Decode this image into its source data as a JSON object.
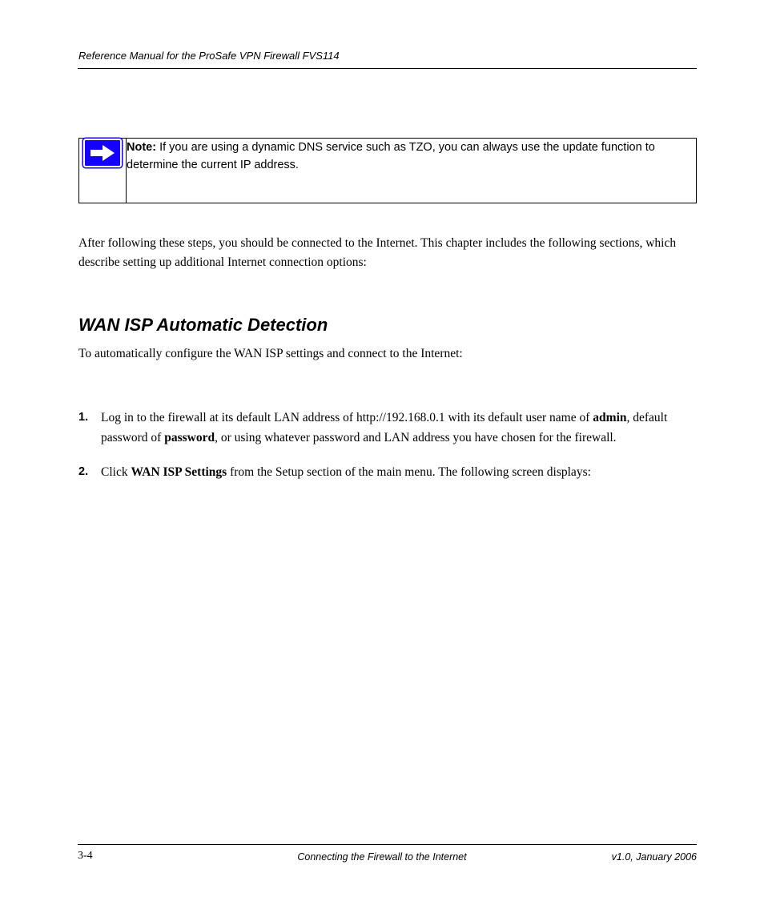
{
  "header": {
    "title": "Reference Manual for the ProSafe VPN Firewall FVS114"
  },
  "note": {
    "label": "Note:",
    "text": "If you are using a dynamic DNS service such as TZO, you can always use the update function to determine the current IP address."
  },
  "intro": "After following these steps, you should be connected to the Internet. This chapter includes the following sections, which describe setting up additional Internet connection options:",
  "heading": "WAN ISP Automatic Detection",
  "heading_intro": "To automatically configure the WAN ISP settings and connect to the Internet:",
  "steps": [
    {
      "num": "1.",
      "l1": "Log in to the firewall at its default LAN address of http://192.168.0.1 with its default user name of ",
      "bold1": "admin",
      "mid": ", default password of ",
      "bold2": "password",
      "l1b": ", or using whatever password and LAN address you have chosen for the firewall."
    },
    {
      "num": "2.",
      "l1": "Click ",
      "bold1": "WAN ISP Settings",
      "l1b": "  from the Setup section of the main menu. The following screen displays:"
    }
  ],
  "footer": {
    "left": "3-4",
    "center": "Connecting the Firewall to the Internet",
    "right": "v1.0, January 2006"
  }
}
